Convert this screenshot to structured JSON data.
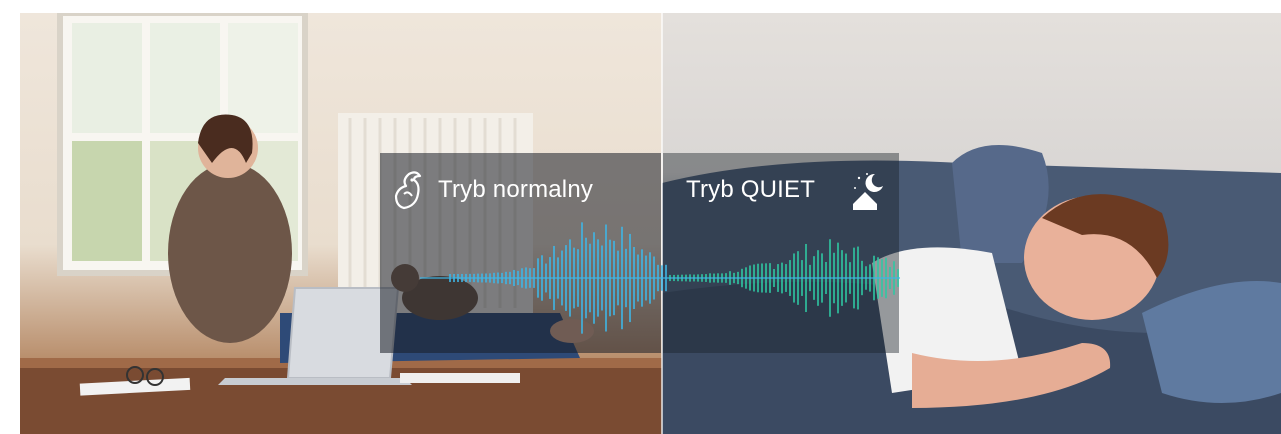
{
  "modes": {
    "normal": {
      "label": "Tryb normalny",
      "icon": "rooster-icon",
      "wave_color": "#3fb6e6"
    },
    "quiet": {
      "label": "Tryb QUIET",
      "icon": "house-moon-stars-icon",
      "wave_color": "#2fc7a3"
    }
  },
  "colors": {
    "divider": "#ffffff",
    "overlay": "#1c212a"
  }
}
